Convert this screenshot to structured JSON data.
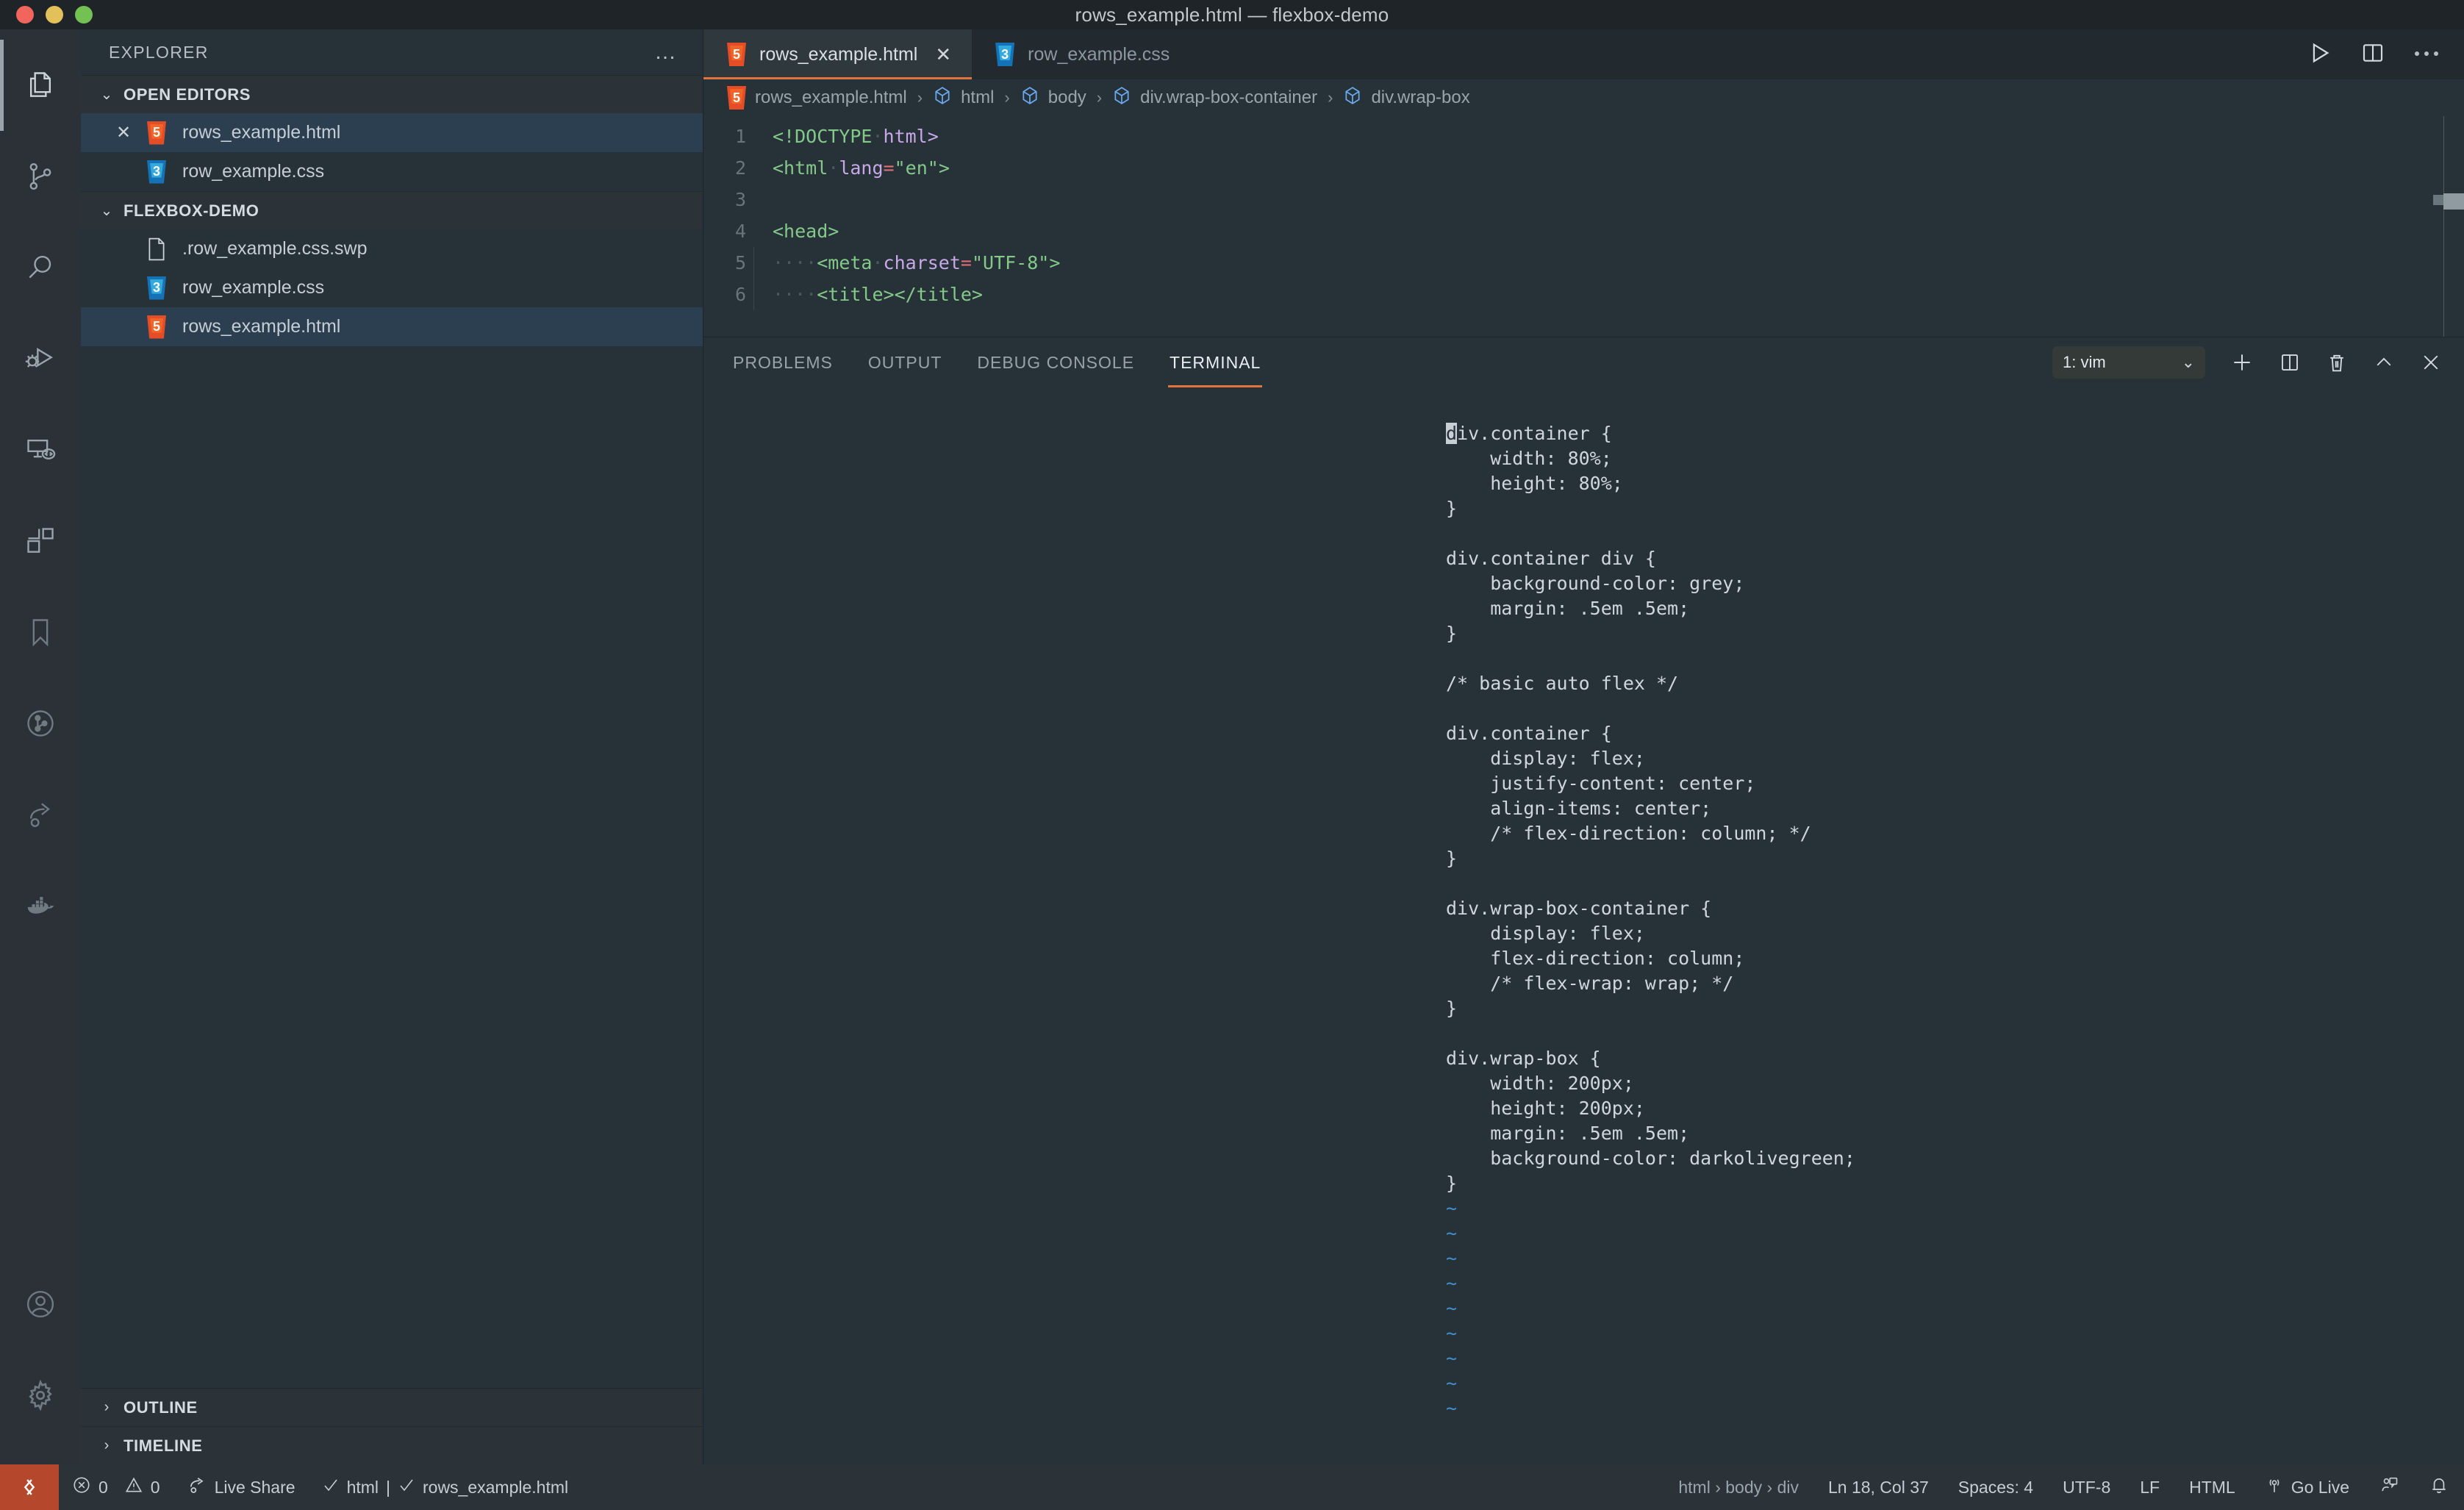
{
  "window": {
    "title": "rows_example.html — flexbox-demo",
    "traffic_lights": [
      "close-red",
      "minimize-yellow",
      "maximize-green"
    ]
  },
  "activity_bar": {
    "items": [
      {
        "name": "explorer",
        "icon": "files-icon",
        "active": true
      },
      {
        "name": "source-control",
        "icon": "source-control-icon",
        "active": false
      },
      {
        "name": "search",
        "icon": "search-icon",
        "active": false
      },
      {
        "name": "run-and-debug",
        "icon": "run-debug-icon",
        "active": false
      },
      {
        "name": "remote-explorer",
        "icon": "remote-explorer-icon",
        "active": false
      },
      {
        "name": "extensions",
        "icon": "extensions-icon",
        "active": false
      },
      {
        "name": "bookmarks",
        "icon": "bookmark-icon",
        "active": false
      },
      {
        "name": "git-graph",
        "icon": "git-graph-icon",
        "active": false
      },
      {
        "name": "live-share",
        "icon": "live-share-icon",
        "active": false
      },
      {
        "name": "docker",
        "icon": "docker-icon",
        "active": false
      }
    ],
    "bottom_items": [
      {
        "name": "accounts",
        "icon": "account-icon"
      },
      {
        "name": "manage-settings",
        "icon": "gear-icon"
      }
    ]
  },
  "sidebar": {
    "title": "EXPLORER",
    "more_actions": "…",
    "sections": [
      {
        "label": "OPEN EDITORS",
        "expanded": true,
        "items": [
          {
            "label": "rows_example.html",
            "icon": "html5-file-icon",
            "badge": "5",
            "has_close": true,
            "selected": true
          },
          {
            "label": "row_example.css",
            "icon": "css3-file-icon",
            "badge": "3",
            "has_close": false,
            "selected": false
          }
        ]
      },
      {
        "label": "FLEXBOX-DEMO",
        "expanded": true,
        "items": [
          {
            "label": ".row_example.css.swp",
            "icon": "generic-file-icon",
            "badge": "",
            "has_close": false,
            "selected": false
          },
          {
            "label": "row_example.css",
            "icon": "css3-file-icon",
            "badge": "3",
            "has_close": false,
            "selected": false
          },
          {
            "label": "rows_example.html",
            "icon": "html5-file-icon",
            "badge": "5",
            "has_close": false,
            "selected": true
          }
        ]
      }
    ],
    "collapsed_sections": [
      {
        "label": "OUTLINE"
      },
      {
        "label": "TIMELINE"
      }
    ]
  },
  "editor": {
    "tabs": [
      {
        "label": "rows_example.html",
        "icon": "html5-file-icon",
        "badge": "5",
        "active": true,
        "close": "✕"
      },
      {
        "label": "row_example.css",
        "icon": "css3-file-icon",
        "badge": "3",
        "active": false,
        "close": ""
      }
    ],
    "actions": [
      {
        "name": "run-file-button",
        "icon": "play-icon"
      },
      {
        "name": "split-editor-button",
        "icon": "split-editor-icon"
      },
      {
        "name": "more-editor-actions-button",
        "icon": "ellipsis-icon"
      }
    ],
    "breadcrumb": [
      {
        "label": "rows_example.html",
        "icon": "html5-file-icon"
      },
      {
        "label": "html",
        "icon": "symbol-cube-icon"
      },
      {
        "label": "body",
        "icon": "symbol-cube-icon"
      },
      {
        "label": "div.wrap-box-container",
        "icon": "symbol-cube-icon"
      },
      {
        "label": "div.wrap-box",
        "icon": "symbol-cube-icon"
      }
    ],
    "breadcrumb_separator": "›",
    "lines": [
      {
        "num": "1",
        "tokens": [
          {
            "t": "<!DOCTYPE",
            "c": "tok-tag"
          },
          {
            "t": "·",
            "c": "ws"
          },
          {
            "t": "html>",
            "c": "tok-attr"
          }
        ]
      },
      {
        "num": "2",
        "tokens": [
          {
            "t": "<html",
            "c": "tok-tag"
          },
          {
            "t": "·",
            "c": "ws"
          },
          {
            "t": "lang",
            "c": "tok-attr"
          },
          {
            "t": "=",
            "c": "tok-eq"
          },
          {
            "t": "\"en\"",
            "c": "tok-str"
          },
          {
            "t": ">",
            "c": "tok-tag"
          }
        ]
      },
      {
        "num": "3",
        "tokens": []
      },
      {
        "num": "4",
        "tokens": [
          {
            "t": "<head>",
            "c": "tok-tag"
          }
        ]
      },
      {
        "num": "5",
        "tokens": [
          {
            "t": "····",
            "c": "ws"
          },
          {
            "t": "<meta",
            "c": "tok-tag"
          },
          {
            "t": "·",
            "c": "ws"
          },
          {
            "t": "charset",
            "c": "tok-attr"
          },
          {
            "t": "=",
            "c": "tok-eq"
          },
          {
            "t": "\"UTF-8\"",
            "c": "tok-str"
          },
          {
            "t": ">",
            "c": "tok-tag"
          }
        ]
      },
      {
        "num": "6",
        "tokens": [
          {
            "t": "····",
            "c": "ws"
          },
          {
            "t": "<title></title>",
            "c": "tok-tag"
          }
        ]
      }
    ]
  },
  "panel": {
    "tabs": [
      {
        "label": "PROBLEMS",
        "active": false
      },
      {
        "label": "OUTPUT",
        "active": false
      },
      {
        "label": "DEBUG CONSOLE",
        "active": false
      },
      {
        "label": "TERMINAL",
        "active": true
      }
    ],
    "terminal_selector": {
      "value": "1: vim",
      "chevron": "⌄"
    },
    "actions": [
      {
        "name": "new-terminal-button",
        "icon": "plus-icon"
      },
      {
        "name": "split-terminal-button",
        "icon": "split-icon"
      },
      {
        "name": "kill-terminal-button",
        "icon": "trash-icon"
      },
      {
        "name": "maximize-panel-button",
        "icon": "chevron-up-icon"
      },
      {
        "name": "close-panel-button",
        "icon": "close-icon"
      }
    ],
    "terminal_lines": [
      "div.container {",
      "    width: 80%;",
      "    height: 80%;",
      "}",
      "",
      "div.container div {",
      "    background-color: grey;",
      "    margin: .5em .5em;",
      "}",
      "",
      "/* basic auto flex */",
      "",
      "div.container {",
      "    display: flex;",
      "    justify-content: center;",
      "    align-items: center;",
      "    /* flex-direction: column; */",
      "}",
      "",
      "div.wrap-box-container {",
      "    display: flex;",
      "    flex-direction: column;",
      "    /* flex-wrap: wrap; */",
      "}",
      "",
      "div.wrap-box {",
      "    width: 200px;",
      "    height: 200px;",
      "    margin: .5em .5em;",
      "    background-color: darkolivegreen;",
      "}",
      "~",
      "~",
      "~",
      "~",
      "~",
      "~",
      "~",
      "~",
      "~"
    ],
    "cursor_char": "d",
    "cursor_line_index": 0
  },
  "status_bar": {
    "remote_icon": "remote-indicator-icon",
    "left_items": [
      {
        "name": "errors-warnings",
        "icon": "error-warning-icon",
        "label": "0",
        "label2": "0"
      },
      {
        "name": "live-share",
        "icon": "live-share-icon",
        "label": "Live Share"
      },
      {
        "name": "html-validation",
        "icon": "check-icon",
        "label": "html | ✓ rows_example.html"
      }
    ],
    "errors_count": "0",
    "warnings_count": "0",
    "live_share_label": "Live Share",
    "lint_label_1": "html",
    "lint_label_2": "rows_example.html",
    "right_items": [
      {
        "name": "breadcrumb-path",
        "label": "html › body › div",
        "dim": true
      },
      {
        "name": "cursor-position",
        "label": "Ln 18, Col 37",
        "dim": false
      },
      {
        "name": "indentation",
        "label": "Spaces: 4",
        "dim": false
      },
      {
        "name": "encoding",
        "label": "UTF-8",
        "dim": false
      },
      {
        "name": "eol",
        "label": "LF",
        "dim": false
      },
      {
        "name": "language-mode",
        "label": "HTML",
        "dim": false
      },
      {
        "name": "go-live",
        "label": "Go Live",
        "dim": false,
        "icon": "broadcast-icon"
      }
    ],
    "feedback_icon": "feedback-icon",
    "notifications_icon": "bell-icon"
  },
  "colors": {
    "accent_orange": "#e0743c",
    "editor_bg": "#263238",
    "activitybar_bg": "#2b3136",
    "titlebar_bg": "#1f2428",
    "selection_blue": "#2c3f51",
    "remote_badge": "#b5482c",
    "tilde_blue": "#3f8fd0",
    "html_orange": "#e44d26",
    "css_blue": "#1572b6"
  }
}
